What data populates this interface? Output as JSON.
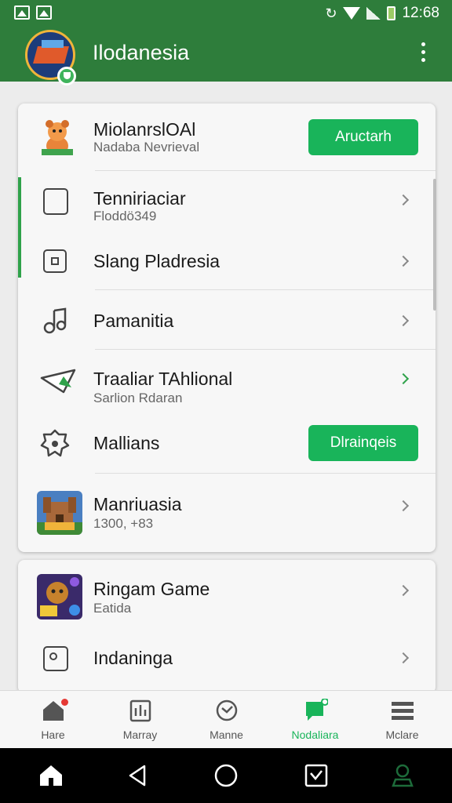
{
  "status_bar": {
    "time": "12:68"
  },
  "app_bar": {
    "title": "Ilodanesia",
    "menu_icon": "more-vert-icon"
  },
  "card1": {
    "header": {
      "title": "MiolanrslOAl",
      "subtitle": "Nadaba Nevrieval",
      "button": "Aructarh",
      "icon": "character-mascot-icon"
    },
    "items": [
      {
        "title": "Tenniriaciar",
        "subtitle": "Floddö349",
        "icon": "tablet-icon"
      },
      {
        "title": "Slang Pladresia",
        "subtitle": "",
        "icon": "square-icon"
      },
      {
        "title": "Pamanitia",
        "subtitle": "",
        "icon": "music-note-icon"
      },
      {
        "title": "Traaliar TAhlional",
        "subtitle": "Sarlion Rdaran",
        "icon": "paper-plane-icon"
      },
      {
        "title": "Mallians",
        "subtitle": "",
        "icon": "gear-badge-icon",
        "button": "Dlrainqeis"
      },
      {
        "title": "Manriuasia",
        "subtitle": "1300, +83",
        "icon": "castle-game-icon"
      }
    ]
  },
  "card2": {
    "items": [
      {
        "title": "Ringam Game",
        "subtitle": "Eatida",
        "icon": "game-thumbnail-icon"
      },
      {
        "title": "Indaninga",
        "subtitle": "",
        "icon": "photo-frame-icon"
      }
    ]
  },
  "bottom_nav": [
    {
      "label": "Hare",
      "icon": "home-icon"
    },
    {
      "label": "Marray",
      "icon": "chart-board-icon"
    },
    {
      "label": "Manne",
      "icon": "clock-icon"
    },
    {
      "label": "Nodaliara",
      "icon": "chat-bubble-icon",
      "active": true
    },
    {
      "label": "Mclare",
      "icon": "menu-lines-icon"
    }
  ],
  "colors": {
    "primary": "#2e7d3b",
    "accent": "#19b45a"
  }
}
